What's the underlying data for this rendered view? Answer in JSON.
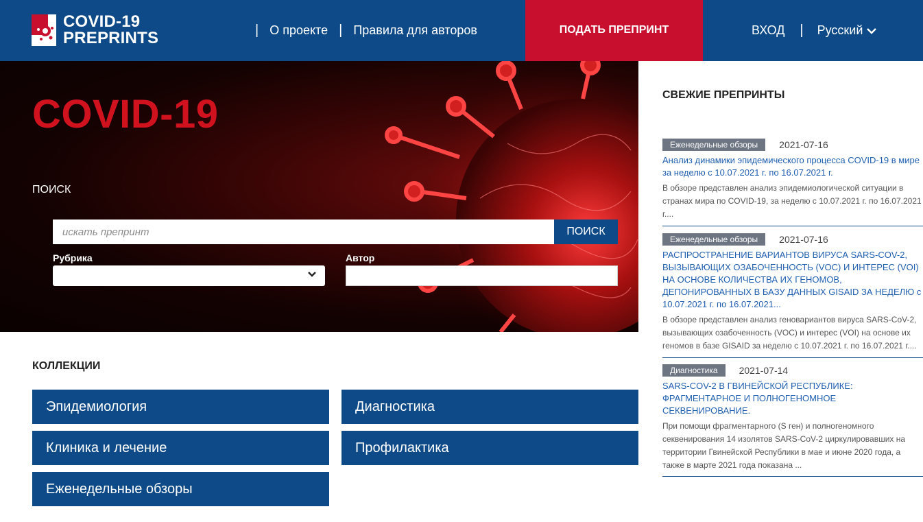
{
  "header": {
    "logo_line1": "COVID-19",
    "logo_line2": "PREPRINTS",
    "nav": [
      "О проекте",
      "Правила для авторов"
    ],
    "submit_label": "ПОДАТЬ ПРЕПРИНТ",
    "login_label": "ВХОД",
    "language": "Русский",
    "separator": "|"
  },
  "hero": {
    "title": "COVID-19",
    "search_label": "ПОИСК",
    "search_placeholder": "искать препринт",
    "search_button": "ПОИСК",
    "rubric_label": "Рубрика",
    "author_label": "Автор",
    "rubric_value": ""
  },
  "collections": {
    "title": "КОЛЛЕКЦИИ",
    "items": [
      "Эпидемиология",
      "Диагностика",
      "Клиника и лечение",
      "Профилактика",
      "Еженедельные обзоры"
    ]
  },
  "sidebar": {
    "title": "СВЕЖИЕ ПРЕПРИНТЫ",
    "items": [
      {
        "badge": "Еженедельные обзоры",
        "date": "2021-07-16",
        "title": "Анализ динамики эпидемического процесса COVID-19 в мире за неделю с 10.07.2021 г. по 16.07.2021 г.",
        "desc": "В обзоре представлен анализ эпидемиологической ситуации в странах мира по COVID-19, за неделю с 10.07.2021 г. по 16.07.2021 г...."
      },
      {
        "badge": "Еженедельные обзоры",
        "date": "2021-07-16",
        "title": "РАСПРОСТРАНЕНИЕ ВАРИАНТОВ ВИРУСА SARS-COV-2, ВЫЗЫВАЮЩИХ ОЗАБОЧЕННОСТЬ (VOC) И ИНТЕРЕС (VOI) НА ОСНОВЕ КОЛИЧЕСТВА ИХ ГЕНОМОВ, ДЕПОНИРОВАННЫХ В БАЗУ ДАННЫХ GISAID ЗА НЕДЕЛЮ с 10.07.2021 г. по 16.07.2021...",
        "desc": "В обзоре представлен анализ геновариантов вируса SARS-CoV-2, вызывающих озабоченность (VOC) и интерес (VOI) на основе их геномов в базе GISAID за неделю с 10.07.2021 г. по 16.07.2021 г...."
      },
      {
        "badge": "Диагностика",
        "date": "2021-07-14",
        "title": "SARS-COV-2 В ГВИНЕЙСКОЙ РЕСПУБЛИКЕ: ФРАГМЕНТАРНОЕ И ПОЛНОГЕНОМНОЕ СЕКВЕНИРОВАНИЕ.",
        "desc": "При помощи фрагментарного (S ген) и полногеномного секвенирования 14 изолятов SARS-CoV-2 циркулировавших на территории Гвинейской Республики в мае и июне 2020 года, а также в марте 2021 года показана ..."
      }
    ]
  },
  "colors": {
    "brand_blue": "#0d4a87",
    "brand_red": "#c8102e",
    "badge_gray": "#6e7582",
    "link_blue": "#1f5fb0"
  }
}
